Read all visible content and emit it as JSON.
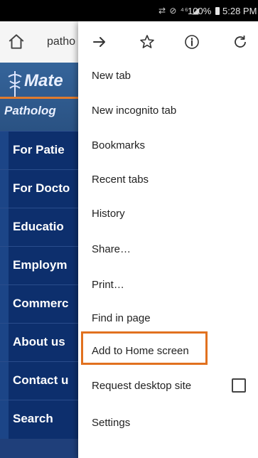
{
  "status_bar": {
    "icons_text": "⇄ ⊘ ⁴⁶ ◢",
    "battery": "100%",
    "time": "5:28 PM"
  },
  "browser": {
    "url_partial": "patho"
  },
  "site": {
    "logo_line1": "Mate",
    "logo_line2": "Patholog",
    "nav_items": [
      "For Patie",
      "For Docto",
      "Educatio",
      "Employm",
      "Commerc",
      "About us",
      "Contact u",
      "Search"
    ]
  },
  "menu": {
    "toolbar_icons": [
      "forward-arrow-icon",
      "bookmark-star-icon",
      "info-icon",
      "refresh-icon"
    ],
    "items": [
      "New tab",
      "New incognito tab",
      "Bookmarks",
      "Recent tabs",
      "History",
      "Share…",
      "Print…",
      "Find in page",
      "Add to Home screen",
      "Request desktop site",
      "Settings"
    ],
    "request_desktop_checked": false
  },
  "colors": {
    "highlight": "#e1711f",
    "nav_bg": "#0d2f6d"
  }
}
